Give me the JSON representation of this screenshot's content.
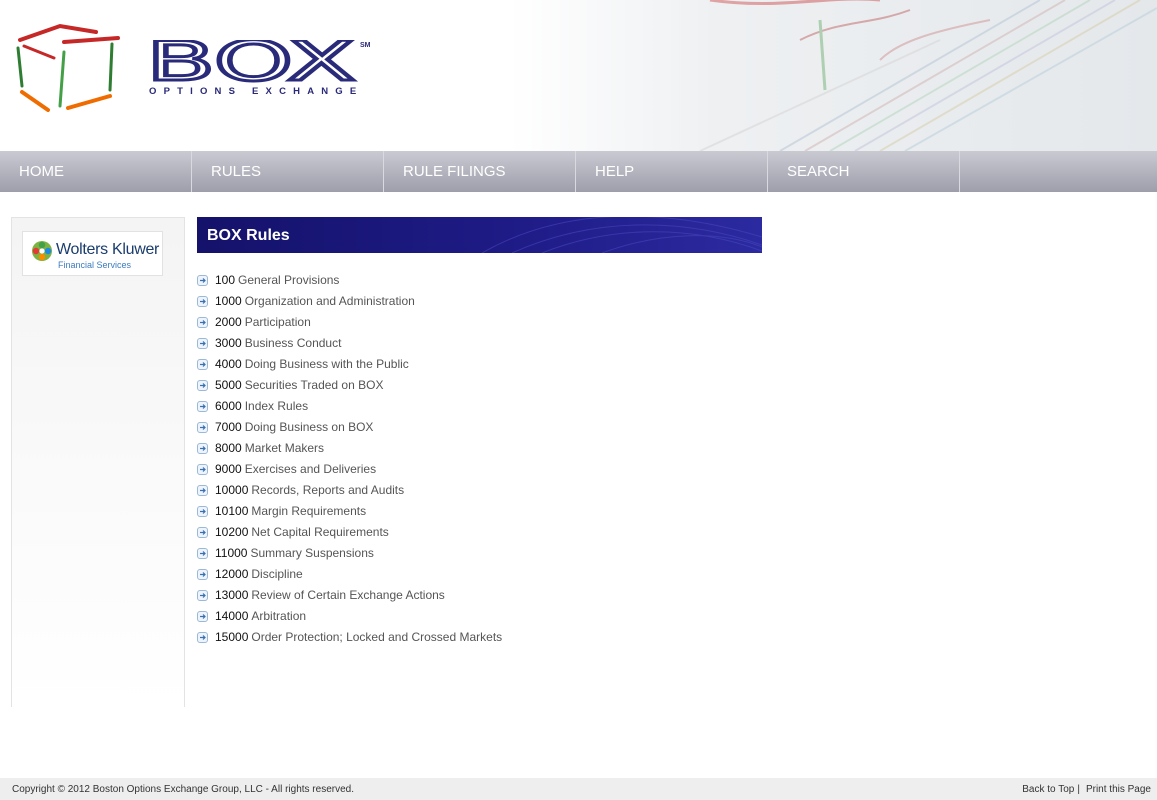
{
  "header": {
    "logo_word": "BOX",
    "logo_sub": "OPTIONS EXCHANGE",
    "logo_sm": "SM"
  },
  "nav": {
    "items": [
      {
        "label": "HOME"
      },
      {
        "label": "RULES"
      },
      {
        "label": "RULE FILINGS"
      },
      {
        "label": "HELP"
      },
      {
        "label": "SEARCH"
      }
    ]
  },
  "sidebar": {
    "partner_name": "Wolters Kluwer",
    "partner_sub": "Financial Services"
  },
  "main": {
    "title": "BOX Rules",
    "rules": [
      {
        "num": "100",
        "title": "General Provisions"
      },
      {
        "num": "1000",
        "title": "Organization and Administration"
      },
      {
        "num": "2000",
        "title": "Participation"
      },
      {
        "num": "3000",
        "title": "Business Conduct"
      },
      {
        "num": "4000",
        "title": "Doing Business with the Public"
      },
      {
        "num": "5000",
        "title": "Securities Traded on BOX"
      },
      {
        "num": "6000",
        "title": "Index Rules"
      },
      {
        "num": "7000",
        "title": "Doing Business on BOX"
      },
      {
        "num": "8000",
        "title": "Market Makers"
      },
      {
        "num": "9000",
        "title": "Exercises and Deliveries"
      },
      {
        "num": "10000",
        "title": "Records, Reports and Audits"
      },
      {
        "num": "10100",
        "title": "Margin Requirements"
      },
      {
        "num": "10200",
        "title": "Net Capital Requirements"
      },
      {
        "num": "11000",
        "title": "Summary Suspensions"
      },
      {
        "num": "12000",
        "title": "Discipline"
      },
      {
        "num": "13000",
        "title": "Review of Certain Exchange Actions"
      },
      {
        "num": "14000",
        "title": "Arbitration"
      },
      {
        "num": "15000",
        "title": "Order Protection; Locked and Crossed Markets"
      }
    ]
  },
  "footer": {
    "copyright": "Copyright © 2012 Boston Options Exchange Group, LLC - All rights reserved.",
    "back_to_top": "Back to Top",
    "separator": "|",
    "print": "Print this Page"
  },
  "colors": {
    "brand_navy": "#2a2a7a",
    "header_bar": "#1e1b86",
    "nav_gray": "#b5b6c0"
  },
  "icons": {
    "rule_bullet": "arrow-right-circle-icon"
  }
}
